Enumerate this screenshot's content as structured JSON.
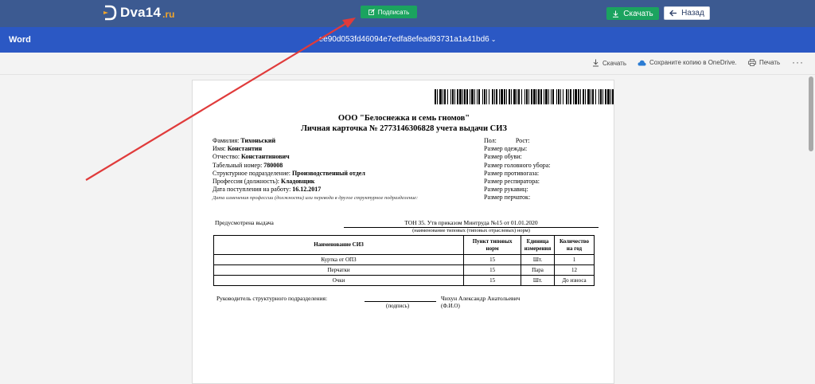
{
  "site": {
    "logo_text": "Dva14",
    "logo_tld": ".ru",
    "sign_label": "Подписать",
    "download_label": "Скачать",
    "back_label": "Назад",
    "colors": {
      "topbar": "#3c5a91",
      "green": "#1ba35f",
      "wordbar": "#2b58c4",
      "annotation": "#e03b3b"
    }
  },
  "word": {
    "app_title": "Word",
    "file_name": "ee90d053fd46094e7edfa8efead93731a1a41bd6",
    "chevron": "⌄"
  },
  "toolbar": {
    "download": "Скачать",
    "onedrive": "Сохраните копию в OneDrive.",
    "print": "Печать",
    "more": "···"
  },
  "document": {
    "org": "ООО \"Белоснежка и семь гномов\"",
    "title": "Личная карточка № 2773146306828 учета выдачи СИЗ",
    "fields": {
      "surname_label": "Фамилия:",
      "surname": "Тихоньский",
      "name_label": "Имя:",
      "name": "Константин",
      "patronymic_label": "Отчество:",
      "patronymic": "Константинович",
      "tabno_label": "Табельный номер:",
      "tabno": "780008",
      "dept_label": "Структурное подразделение:",
      "dept": "Производственный отдел",
      "prof_label": "Профессия (должность):",
      "prof": "Кладовщик",
      "hire_label": "Дата поступления на работу:",
      "hire": "16.12.2017",
      "change_note": "Дата изменения профессии (должности) или перевода в другое структурное подразделение:"
    },
    "right_fields": {
      "gender": "Пол:",
      "height": "Рост:",
      "clothes": "Размер одежды:",
      "shoes": "Размер обуви:",
      "hat": "Размер головного убора:",
      "gasmask": "Размер противогаза:",
      "respirator": "Размер респиратора:",
      "mittens": "Размер рукавиц:",
      "gloves": "Размер перчаток:"
    },
    "provided_label": "Предусмотрена выдача",
    "norm_value": "ТОН 35. Утв приказом Минтруда №15 от 01.01.2020",
    "norm_caption": "(наименование типовых (типовых отраслевых) норм)",
    "table": {
      "headers": [
        "Наименование СИЗ",
        "Пункт типовых норм",
        "Единица измерения",
        "Количество на год"
      ],
      "rows": [
        [
          "Куртка от ОПЗ",
          "15",
          "Шт.",
          "1"
        ],
        [
          "Перчатки",
          "15",
          "Пара",
          "12"
        ],
        [
          "Очки",
          "15",
          "Шт.",
          "До износа"
        ]
      ]
    },
    "head_label": "Руководитель структурного подразделения:",
    "sign_caption": "(подпись)",
    "head_name": "Чихун Александр Анатольевич",
    "fio_caption": "(Ф.И.О)"
  }
}
